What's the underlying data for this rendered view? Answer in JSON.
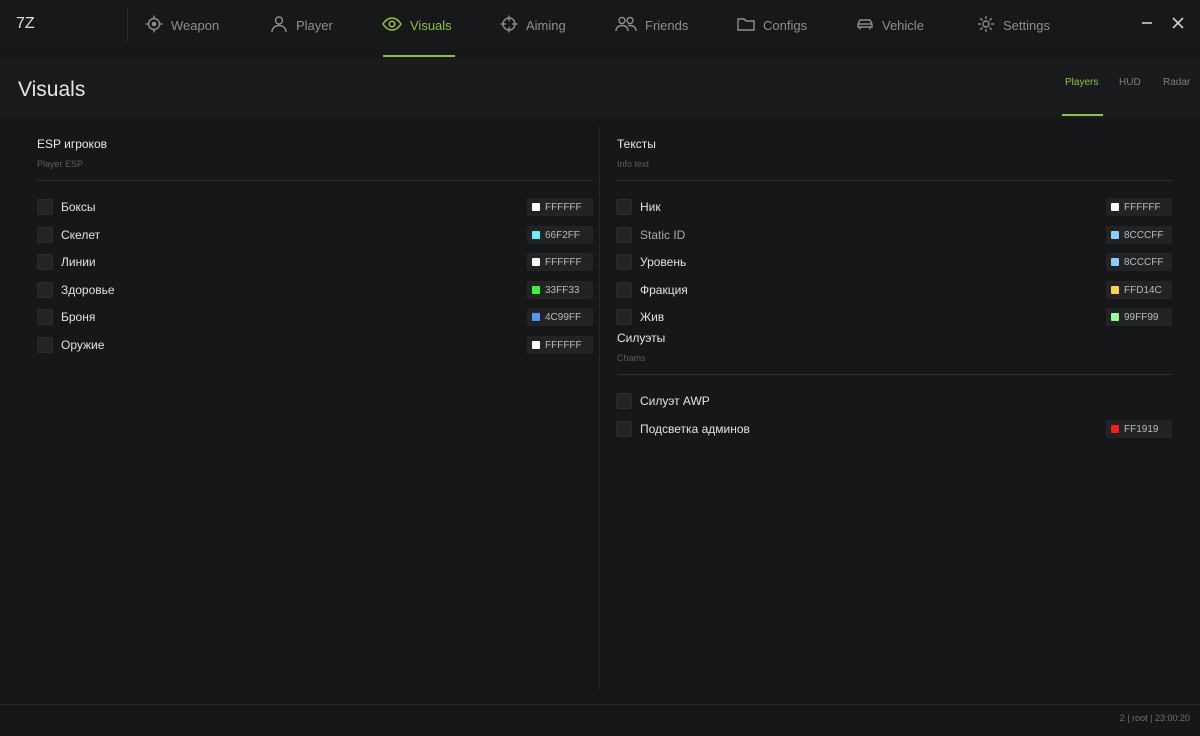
{
  "app": {
    "logo": "7Z"
  },
  "nav": [
    {
      "label": "Weapon",
      "icon": "crosshair-icon"
    },
    {
      "label": "Player",
      "icon": "user-icon"
    },
    {
      "label": "Visuals",
      "icon": "eye-icon",
      "active": true
    },
    {
      "label": "Aiming",
      "icon": "target-icon"
    },
    {
      "label": "Friends",
      "icon": "users-icon"
    },
    {
      "label": "Configs",
      "icon": "folder-icon"
    },
    {
      "label": "Vehicle",
      "icon": "car-icon"
    },
    {
      "label": "Settings",
      "icon": "gear-icon"
    }
  ],
  "window": {
    "minimize": "—",
    "close": "✕"
  },
  "header": {
    "title": "Visuals",
    "subtabs": [
      {
        "label": "Players",
        "active": true
      },
      {
        "label": "HUD"
      },
      {
        "label": "Radar"
      }
    ]
  },
  "left": {
    "title": "ESP игроков",
    "subtitle": "Player ESP",
    "rows": [
      {
        "label": "Боксы",
        "color": "FFFFFF",
        "swatch": "#FFFFFF"
      },
      {
        "label": "Скелет",
        "color": "66F2FF",
        "swatch": "#66F2FF"
      },
      {
        "label": "Линии",
        "color": "FFFFFF",
        "swatch": "#FFFFFF"
      },
      {
        "label": "Здоровье",
        "color": "33FF33",
        "swatch": "#33FF33"
      },
      {
        "label": "Броня",
        "color": "4C99FF",
        "swatch": "#4C99FF"
      },
      {
        "label": "Оружие",
        "color": "FFFFFF",
        "swatch": "#FFFFFF"
      }
    ]
  },
  "right": {
    "title": "Тексты",
    "subtitle": "Info text",
    "rows": [
      {
        "label": "Ник",
        "color": "FFFFFF",
        "swatch": "#FFFFFF"
      },
      {
        "label": "Static ID",
        "color": "8CCCFF",
        "swatch": "#8CCCFF"
      },
      {
        "label": "Уровень",
        "color": "8CCCFF",
        "swatch": "#8CCCFF"
      },
      {
        "label": "Фракция",
        "color": "FFD14C",
        "swatch": "#FFD14C"
      },
      {
        "label": "Жив",
        "color": "99FF99",
        "swatch": "#99FF99"
      }
    ],
    "chams_title": "Силуэты",
    "chams_subtitle": "Chams",
    "chams_rows": [
      {
        "label": "Силуэт AWP"
      },
      {
        "label": "Подсветка админов",
        "color": "FF1919",
        "swatch": "#FF1919"
      }
    ]
  },
  "status": "2 | root | 23:00:20",
  "colors": {
    "accent": "#8FC33A",
    "background": "#161718"
  }
}
